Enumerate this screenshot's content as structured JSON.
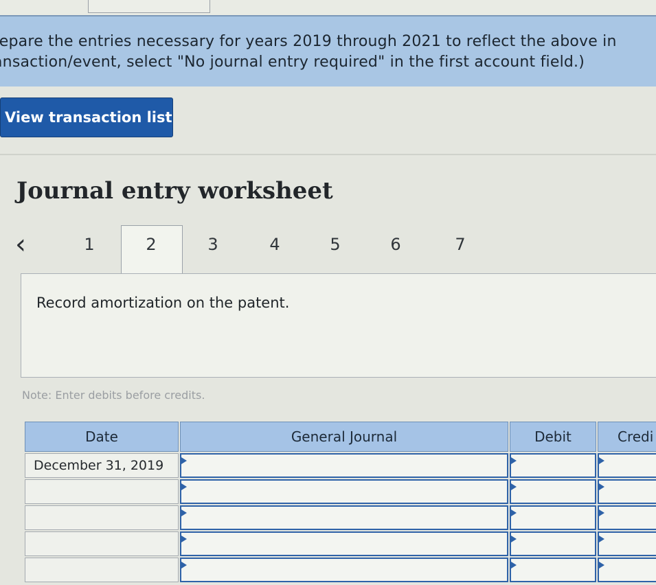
{
  "instructions": {
    "line1": "repare the entries necessary for years 2019 through 2021 to reflect the above in",
    "line2": "ansaction/event, select \"No journal entry required\" in the first account field.)"
  },
  "buttons": {
    "view_transaction_list": "View transaction list"
  },
  "worksheet": {
    "title": "Journal entry worksheet",
    "tabs": [
      "1",
      "2",
      "3",
      "4",
      "5",
      "6",
      "7"
    ],
    "active_tab": "2",
    "description": "Record amortization on the patent.",
    "note": "Note: Enter debits before credits."
  },
  "journal": {
    "headers": {
      "date": "Date",
      "general_journal": "General Journal",
      "debit": "Debit",
      "credit": "Credi"
    },
    "rows": [
      {
        "date": "December 31, 2019"
      },
      {
        "date": ""
      },
      {
        "date": ""
      },
      {
        "date": ""
      },
      {
        "date": ""
      }
    ]
  }
}
